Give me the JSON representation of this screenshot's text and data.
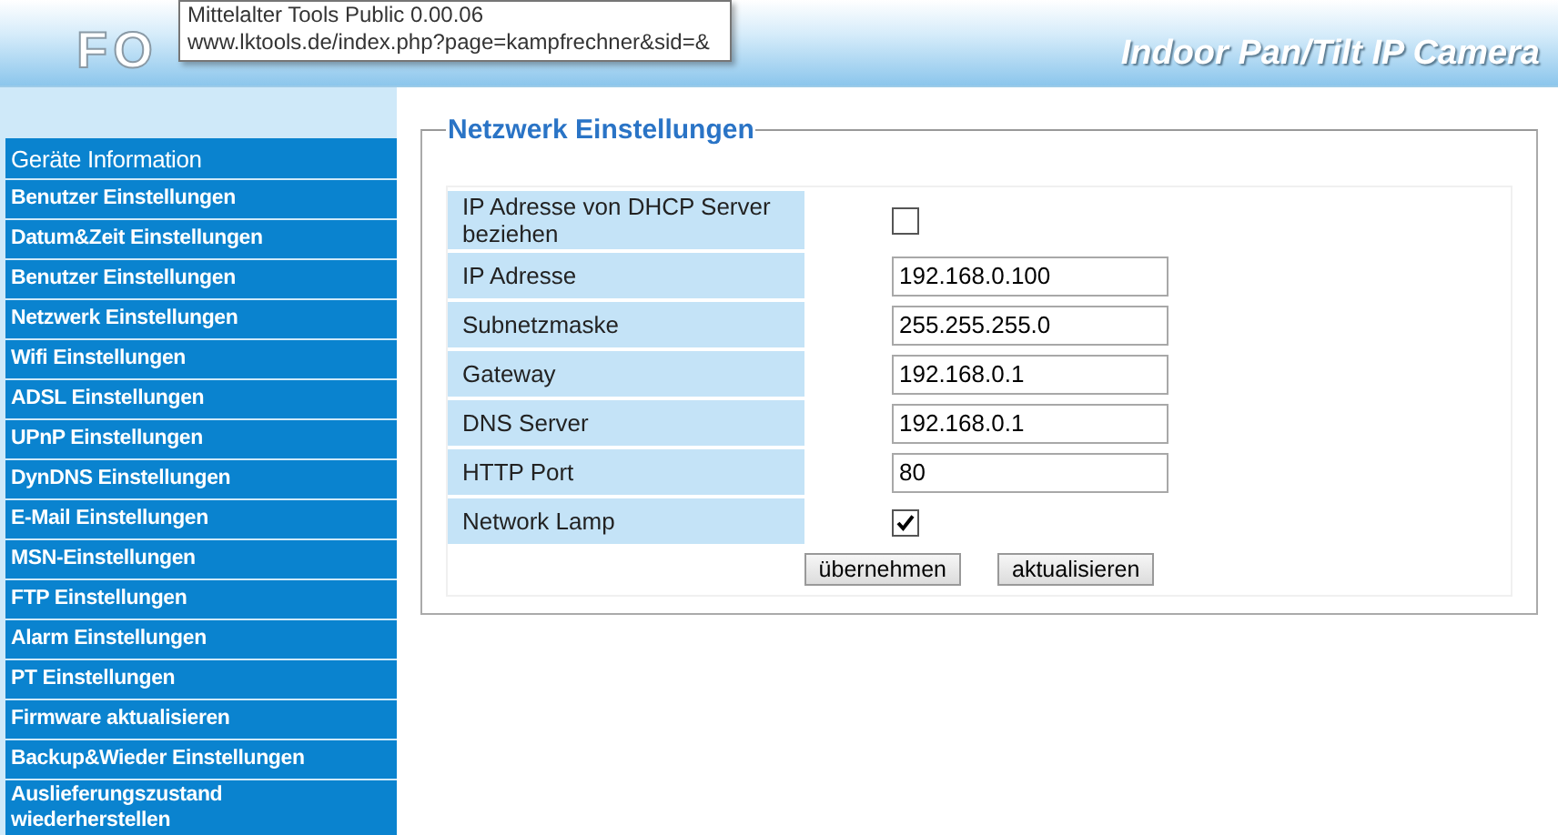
{
  "header": {
    "logo": "FO",
    "product": "Indoor Pan/Tilt IP Camera"
  },
  "tooltip": {
    "lines": [
      "Mittelalter Tools Public 0.00.06",
      "www.lktools.de/index.php?page=kampfrechner&sid=&"
    ]
  },
  "sidebar": {
    "items": [
      {
        "label": "Geräte Information",
        "kind": "heading"
      },
      {
        "label": "Benutzer Einstellungen",
        "kind": "link"
      },
      {
        "label": "Datum&Zeit Einstellungen",
        "kind": "link"
      },
      {
        "label": "Benutzer Einstellungen",
        "kind": "link"
      },
      {
        "label": "Netzwerk Einstellungen",
        "kind": "link"
      },
      {
        "label": "Wifi Einstellungen",
        "kind": "link"
      },
      {
        "label": "ADSL Einstellungen",
        "kind": "link"
      },
      {
        "label": "UPnP Einstellungen",
        "kind": "link"
      },
      {
        "label": "DynDNS Einstellungen",
        "kind": "link"
      },
      {
        "label": "E-Mail Einstellungen",
        "kind": "link"
      },
      {
        "label": "MSN-Einstellungen",
        "kind": "link"
      },
      {
        "label": "FTP Einstellungen",
        "kind": "link"
      },
      {
        "label": "Alarm Einstellungen",
        "kind": "link"
      },
      {
        "label": "PT Einstellungen",
        "kind": "link"
      },
      {
        "label": "Firmware aktualisieren",
        "kind": "link"
      },
      {
        "label": "Backup&Wieder Einstellungen",
        "kind": "link"
      },
      {
        "label": "Auslieferungszustand wiederherstellen",
        "kind": "link"
      }
    ]
  },
  "panel": {
    "title": "Netzwerk Einstellungen",
    "rows": [
      {
        "label": "IP Adresse von DHCP Server beziehen",
        "kind": "checkbox",
        "checked": false
      },
      {
        "label": "IP Adresse",
        "kind": "text",
        "value": "192.168.0.100"
      },
      {
        "label": "Subnetzmaske",
        "kind": "text",
        "value": "255.255.255.0"
      },
      {
        "label": "Gateway",
        "kind": "text",
        "value": "192.168.0.1"
      },
      {
        "label": "DNS Server",
        "kind": "text",
        "value": "192.168.0.1"
      },
      {
        "label": "HTTP Port",
        "kind": "text",
        "value": "80"
      },
      {
        "label": "Network Lamp",
        "kind": "checkbox",
        "checked": true
      }
    ],
    "buttons": [
      "übernehmen",
      "aktualisieren"
    ]
  }
}
